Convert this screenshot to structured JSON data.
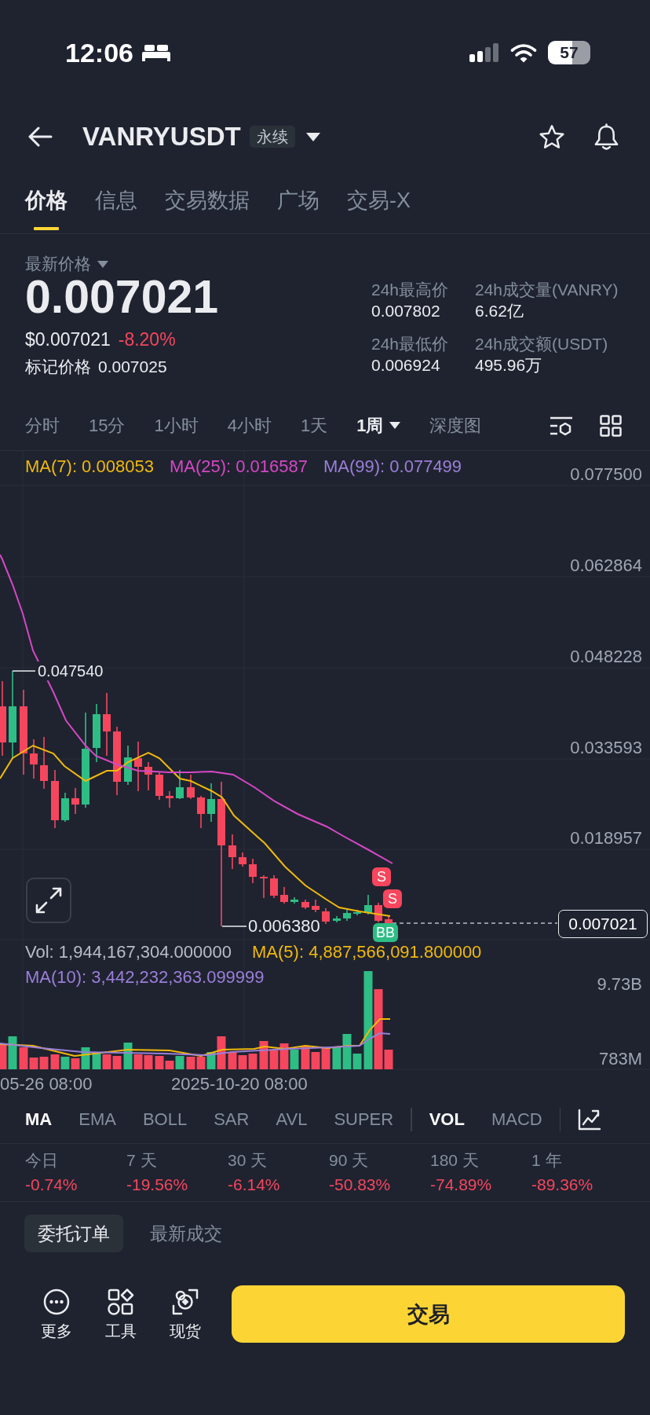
{
  "status_bar": {
    "time": "12:06",
    "battery": "57"
  },
  "header": {
    "symbol": "VANRYUSDT",
    "badge": "永续"
  },
  "tabs": [
    {
      "label": "价格",
      "selected": true
    },
    {
      "label": "信息",
      "selected": false
    },
    {
      "label": "交易数据",
      "selected": false
    },
    {
      "label": "广场",
      "selected": false
    },
    {
      "label": "交易-X",
      "selected": false
    }
  ],
  "price": {
    "label": "最新价格",
    "last": "0.007021",
    "usd": "$0.007021",
    "change": "-8.20%",
    "negative": true,
    "mark_label": "标记价格",
    "mark_value": "0.007025"
  },
  "stats": [
    {
      "label": "24h最高价",
      "value": "0.007802"
    },
    {
      "label": "24h成交量(VANRY)",
      "value": "6.62亿"
    },
    {
      "label": "24h最低价",
      "value": "0.006924"
    },
    {
      "label": "24h成交额(USDT)",
      "value": "495.96万"
    }
  ],
  "intervals": [
    {
      "label": "分时",
      "selected": false,
      "menu": false
    },
    {
      "label": "15分",
      "selected": false,
      "menu": false
    },
    {
      "label": "1小时",
      "selected": false,
      "menu": false
    },
    {
      "label": "4小时",
      "selected": false,
      "menu": false
    },
    {
      "label": "1天",
      "selected": false,
      "menu": false
    },
    {
      "label": "1周",
      "selected": true,
      "menu": true
    },
    {
      "label": "深度图",
      "selected": false,
      "menu": false
    }
  ],
  "chart": {
    "legend": [
      {
        "label": "MA(7): 0.008053",
        "color": "#f0b90b"
      },
      {
        "label": "MA(25): 0.016587",
        "color": "#d548c4"
      },
      {
        "label": "MA(99): 0.077499",
        "color": "#9b7fd8"
      }
    ],
    "price_labels": [
      "0.077500",
      "0.062864",
      "0.048228",
      "0.033593",
      "0.018957"
    ],
    "high_label": "0.047540",
    "low_label": "0.006380",
    "last_price_tag": "0.007021",
    "markers": [
      {
        "label": "S",
        "kind": "sell"
      },
      {
        "label": "S",
        "kind": "sell"
      },
      {
        "label": "BB",
        "kind": "buy"
      }
    ]
  },
  "volume": {
    "legend": [
      {
        "label": "Vol: 1,944,167,304.000000",
        "color": "#b7bdc6"
      },
      {
        "label": "MA(5): 4,887,566,091.800000",
        "color": "#f0b90b"
      },
      {
        "label": "MA(10): 3,442,232,363.099999",
        "color": "#9b7fd8"
      }
    ],
    "axis_labels": [
      "9.73B",
      "783M"
    ],
    "time_labels": [
      "05-26 08:00",
      "2025-10-20 08:00"
    ]
  },
  "main_indicators": [
    {
      "label": "MA",
      "selected": true
    },
    {
      "label": "EMA",
      "selected": false
    },
    {
      "label": "BOLL",
      "selected": false
    },
    {
      "label": "SAR",
      "selected": false
    },
    {
      "label": "AVL",
      "selected": false
    },
    {
      "label": "SUPER",
      "selected": false
    }
  ],
  "sub_indicators": [
    {
      "label": "VOL",
      "selected": true
    },
    {
      "label": "MACD",
      "selected": false
    }
  ],
  "performance": [
    {
      "period": "今日",
      "change": "-0.74%",
      "negative": true
    },
    {
      "period": "7 天",
      "change": "-19.56%",
      "negative": true
    },
    {
      "period": "30 天",
      "change": "-6.14%",
      "negative": true
    },
    {
      "period": "90 天",
      "change": "-50.83%",
      "negative": true
    },
    {
      "period": "180 天",
      "change": "-74.89%",
      "negative": true
    },
    {
      "period": "1 年",
      "change": "-89.36%",
      "negative": true
    }
  ],
  "order_tabs": [
    {
      "label": "委托订单",
      "selected": true
    },
    {
      "label": "最新成交",
      "selected": false
    }
  ],
  "bottom_bar": {
    "actions": [
      "更多",
      "工具",
      "现货"
    ],
    "trade_button": "交易"
  }
}
